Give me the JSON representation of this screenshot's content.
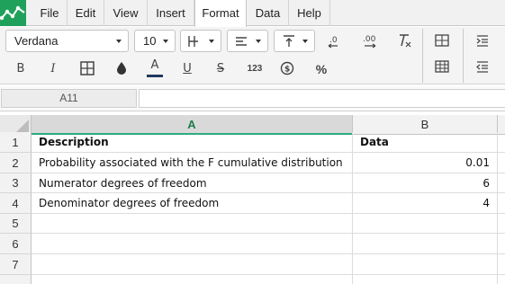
{
  "menu": {
    "items": [
      {
        "id": "file",
        "label": "File"
      },
      {
        "id": "edit",
        "label": "Edit"
      },
      {
        "id": "view",
        "label": "View"
      },
      {
        "id": "insert",
        "label": "Insert"
      },
      {
        "id": "format",
        "label": "Format",
        "active": true
      },
      {
        "id": "data",
        "label": "Data"
      },
      {
        "id": "help",
        "label": "Help"
      }
    ]
  },
  "toolbar": {
    "font_name": "Verdana",
    "font_size": "10",
    "bold": "B",
    "italic": "I",
    "font_color_glyph": "A",
    "underline": "U",
    "strikethrough": "S",
    "number_format": "123",
    "percent": "%",
    "font_color": "#1f3a5f"
  },
  "formula_bar": {
    "cell_reference": "A11",
    "formula": ""
  },
  "sheet": {
    "columns": [
      "A",
      "B"
    ],
    "selected_column": "A",
    "rows": [
      {
        "num": "1",
        "a": "Description",
        "b": "Data",
        "header": true
      },
      {
        "num": "2",
        "a": "Probability associated with the F cumulative distribution",
        "b": "0.01"
      },
      {
        "num": "3",
        "a": "Numerator degrees of freedom",
        "b": "6"
      },
      {
        "num": "4",
        "a": "Denominator degrees of freedom",
        "b": "4"
      },
      {
        "num": "5",
        "a": "",
        "b": ""
      },
      {
        "num": "6",
        "a": "",
        "b": ""
      },
      {
        "num": "7",
        "a": "",
        "b": ""
      }
    ]
  },
  "colors": {
    "accent_green": "#1fa15b",
    "selected_column_underline": "#2eaa82"
  }
}
